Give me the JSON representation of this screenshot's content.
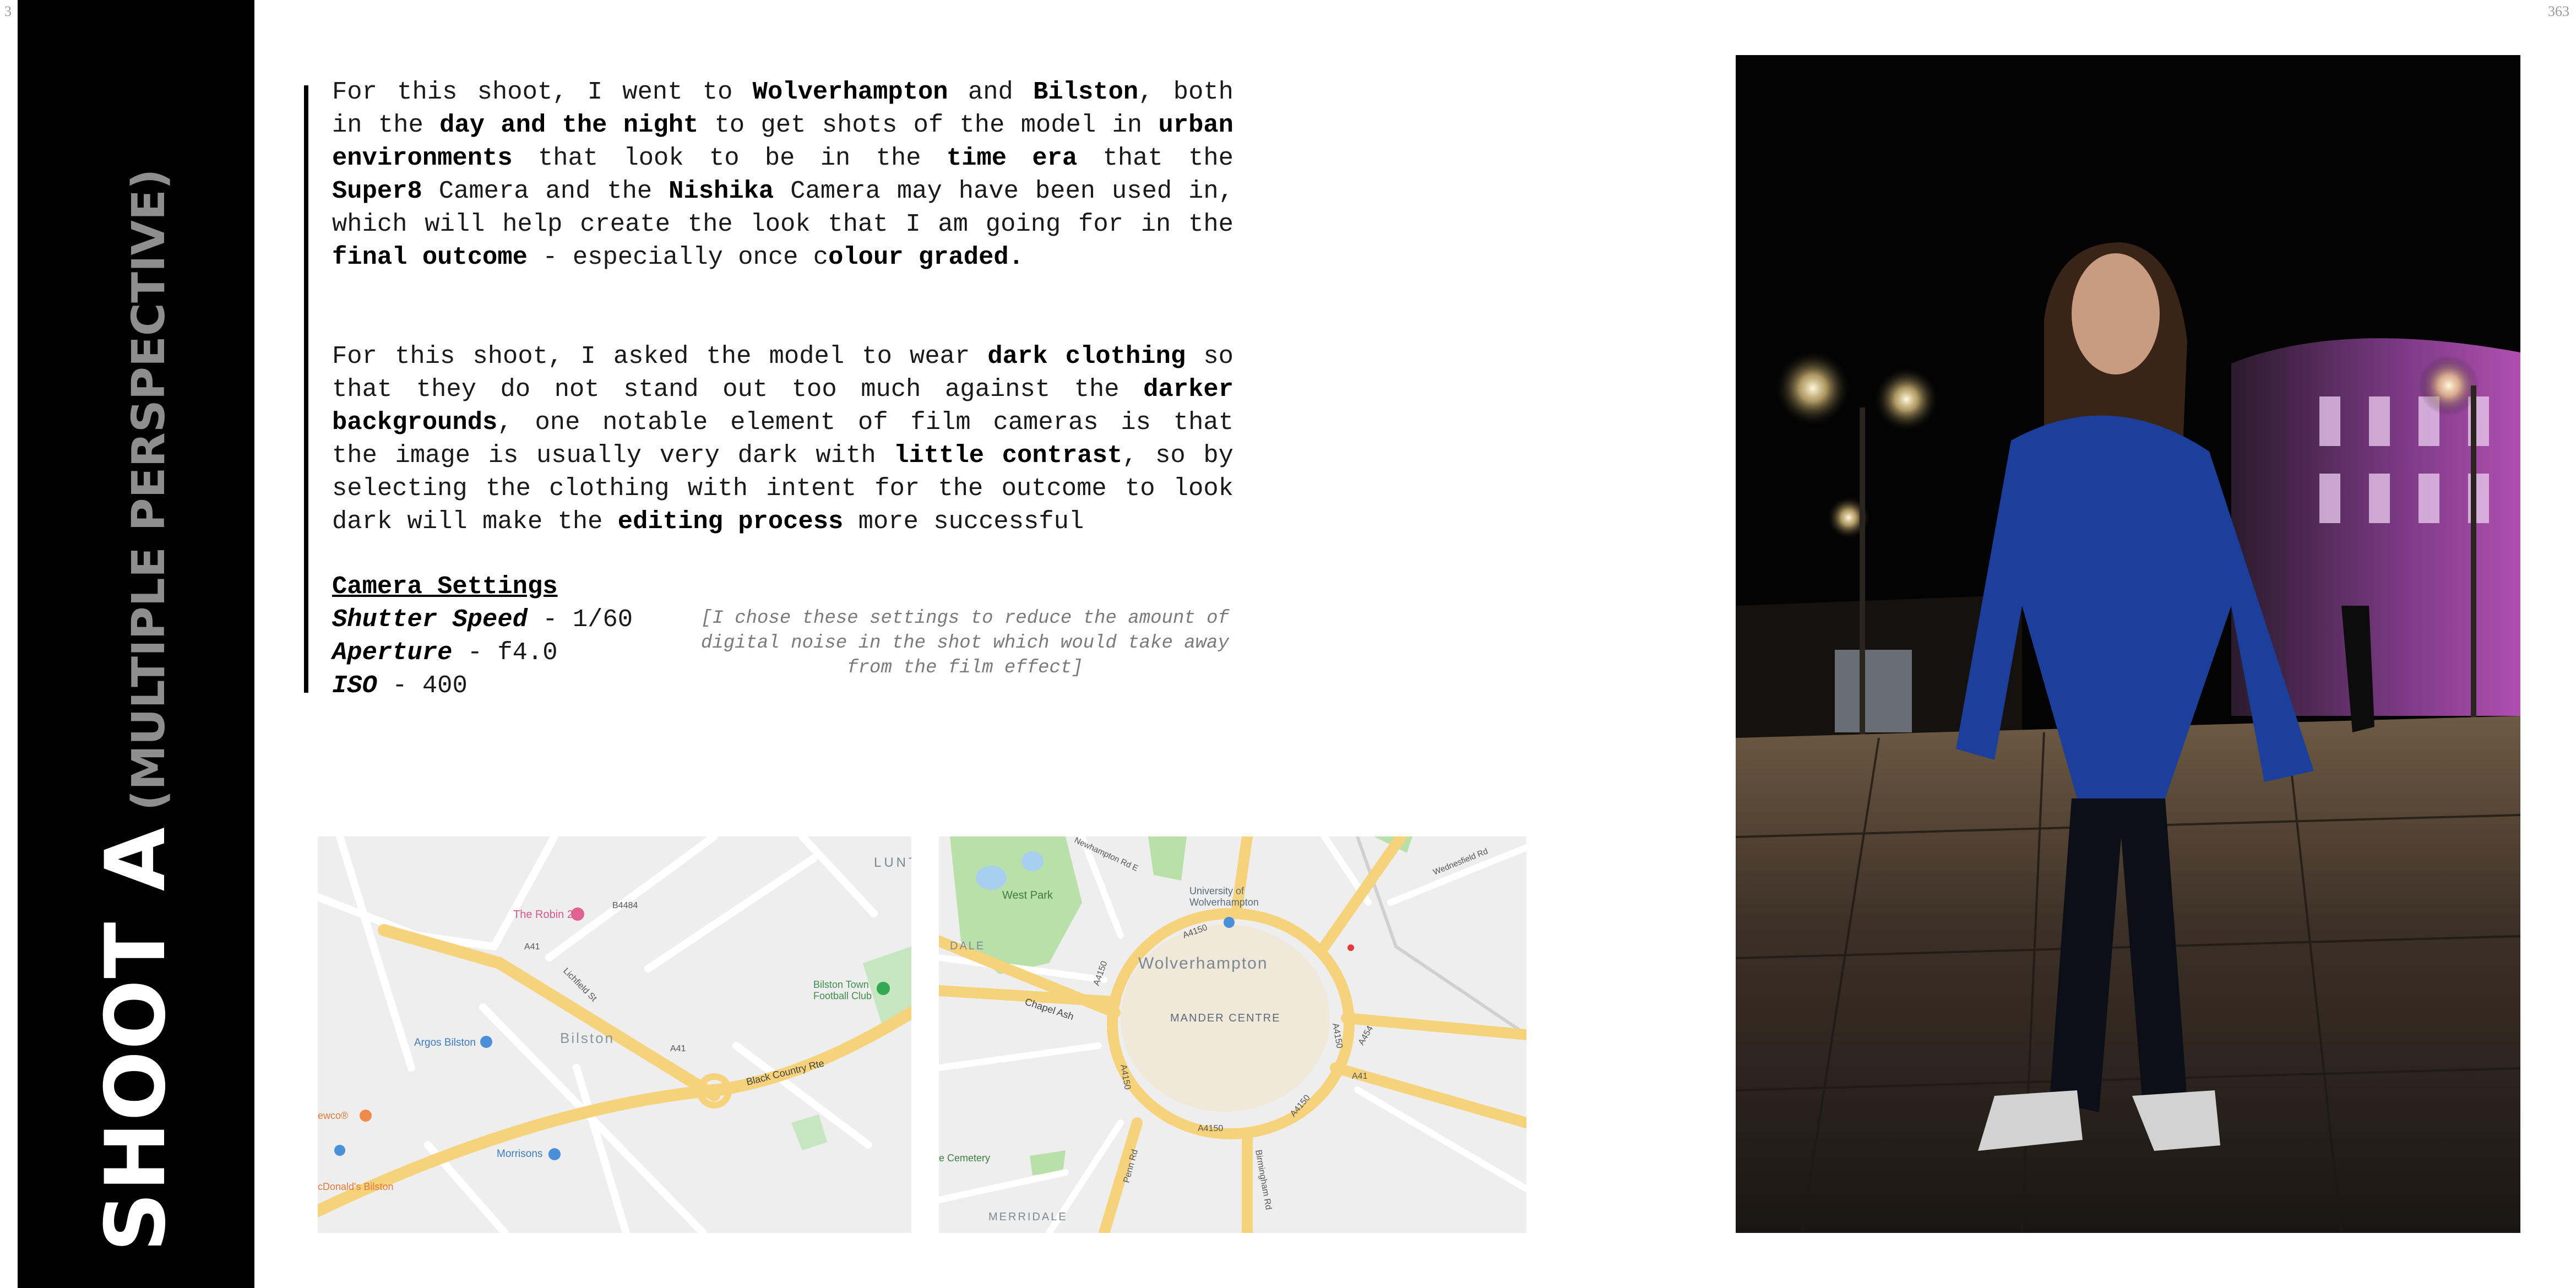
{
  "page_numbers": {
    "left": "3",
    "right": "363"
  },
  "side_title": {
    "main": "SHOOT A",
    "sub": "(MULTIPLE PERSPECTIVE)"
  },
  "paragraph_1": [
    {
      "text": "For this shoot, I went to ",
      "bold": false
    },
    {
      "text": "Wolverhampton",
      "bold": true
    },
    {
      "text": " and ",
      "bold": false
    },
    {
      "text": "Bilston",
      "bold": true
    },
    {
      "text": ", both in the ",
      "bold": false
    },
    {
      "text": "day and the night",
      "bold": true
    },
    {
      "text": " to get shots of the model in ",
      "bold": false
    },
    {
      "text": "urban environments",
      "bold": true
    },
    {
      "text": " that look to be in the ",
      "bold": false
    },
    {
      "text": "time era",
      "bold": true
    },
    {
      "text": " that the ",
      "bold": false
    },
    {
      "text": "Super8",
      "bold": true
    },
    {
      "text": " Camera and the ",
      "bold": false
    },
    {
      "text": "Nishika",
      "bold": true
    },
    {
      "text": " Camera may have been used in, which will help create the look that I am going for in the ",
      "bold": false
    },
    {
      "text": "final outcome",
      "bold": true
    },
    {
      "text": " - especially once c",
      "bold": false
    },
    {
      "text": "olour graded.",
      "bold": true
    }
  ],
  "paragraph_2": [
    {
      "text": "For this shoot, I asked the model to wear ",
      "bold": false
    },
    {
      "text": "dark clothing",
      "bold": true
    },
    {
      "text": " so that they do not stand out too much against the ",
      "bold": false
    },
    {
      "text": "darker backgrounds",
      "bold": true
    },
    {
      "text": ", one notable element of film cameras is that the image is usually very dark with ",
      "bold": false
    },
    {
      "text": "little contrast",
      "bold": true
    },
    {
      "text": ", so by selecting the clothing with intent for the outcome to look dark will make the ",
      "bold": false
    },
    {
      "text": "editing process",
      "bold": true
    },
    {
      "text": " more successful",
      "bold": false
    }
  ],
  "camera_settings": {
    "heading": "Camera Settings",
    "rows": [
      {
        "name": "Shutter Speed",
        "value": " - 1/60"
      },
      {
        "name": "Aperture",
        "value": " - f4.0"
      },
      {
        "name": "ISO",
        "value": " - 400"
      }
    ],
    "note": "[I chose these settings to reduce the amount of digital noise in the shot which would take away from the film effect]"
  },
  "map_bilston": {
    "labels": {
      "lunt": "LUNT",
      "robin": "The Robin 2",
      "bilston": "Bilston",
      "football": "Bilston Town\nFootball Club",
      "argos": "Argos Bilston",
      "morrisons": "Morrisons",
      "newco": "ewco®",
      "mcdonalds": "cDonald's Bilston",
      "black_country": "Black Country Rte",
      "a41_a": "A41",
      "a41_b": "A41",
      "b4484": "B4484",
      "lichfield": "Lichfield St"
    },
    "colors": {
      "road_major": "#f6d27a",
      "road_minor": "#ffffff",
      "park": "#c5e6bf",
      "land": "#eeeeee",
      "pin": "#4a90d9",
      "poi_pink": "#e06292",
      "poi_orange": "#f08a4b"
    }
  },
  "map_wolverhampton": {
    "labels": {
      "west_park": "West Park",
      "dale": "DALE",
      "university": "University of\nWolverhampton",
      "wolverhampton": "Wolverhampton",
      "mander": "MANDER CENTRE",
      "chapel_ash": "Chapel Ash",
      "cemetery": "e Cemetery",
      "merridale": "MERRIDALE",
      "a4150_a": "A4150",
      "a4150_b": "A4150",
      "a4150_c": "A4150",
      "a4150_d": "A4150",
      "a4150_e": "A4150",
      "a4150_f": "A4150",
      "a41": "A41",
      "a454": "A454",
      "penn_rd": "Penn Rd",
      "birmingham_rd": "Birmingham Rd",
      "newhampton": "Newhampton Rd E",
      "wednesfield": "Wednesfield Rd"
    },
    "colors": {
      "road_major": "#f6d27a",
      "park": "#b9e0a8",
      "water": "#a8cff0",
      "land": "#eeeeee"
    }
  },
  "photo": {
    "description_icon": "night-street-portrait",
    "colors": {
      "sky": "#030303",
      "building_light": "#b04fb0",
      "jacket": "#1d3f9c",
      "pavement": "#4b3c30"
    }
  }
}
